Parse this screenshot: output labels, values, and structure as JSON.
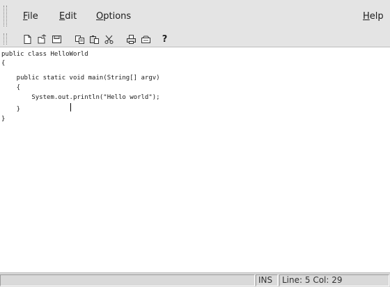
{
  "menu": {
    "file": {
      "mnemonic": "F",
      "rest": "ile"
    },
    "edit": {
      "mnemonic": "E",
      "rest": "dit"
    },
    "options": {
      "mnemonic": "O",
      "rest": "ptions"
    },
    "help": {
      "mnemonic": "H",
      "rest": "elp"
    }
  },
  "toolbar": {
    "buttons": [
      {
        "icon": "new-file-icon"
      },
      {
        "icon": "open-file-icon"
      },
      {
        "icon": "save-icon"
      },
      {
        "icon": "copy-icon"
      },
      {
        "icon": "paste-icon"
      },
      {
        "icon": "cut-icon"
      },
      {
        "icon": "print-icon"
      },
      {
        "icon": "print-preview-icon"
      },
      {
        "icon": "help-icon",
        "label": "?"
      }
    ]
  },
  "editor": {
    "lines": [
      "public class HelloWorld",
      "{",
      "    public static void main(String[] argv)",
      "    {",
      "        System.out.println(\"Hello world\");",
      "    }",
      "}"
    ]
  },
  "statusbar": {
    "mode": "INS",
    "position": "Line: 5 Col: 29"
  }
}
